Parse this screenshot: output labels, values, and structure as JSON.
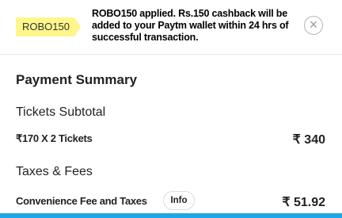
{
  "promo": {
    "coupon_code": "ROBO150",
    "message": "ROBO150 applied. Rs.150 cashback will be added to your Paytm wallet within 24 hrs of successful transaction.",
    "close_icon": "×"
  },
  "summary": {
    "title": "Payment Summary",
    "tickets": {
      "section_label": "Tickets Subtotal",
      "detail": "₹170 X 2 Tickets",
      "amount": "₹ 340"
    },
    "fees": {
      "section_label": "Taxes & Fees",
      "detail": "Convenience Fee and Taxes",
      "info_label": "Info",
      "amount": "₹ 51.92"
    }
  },
  "colors": {
    "coupon_bg": "#fff68a",
    "accent_bar": "#1ea8e0"
  }
}
